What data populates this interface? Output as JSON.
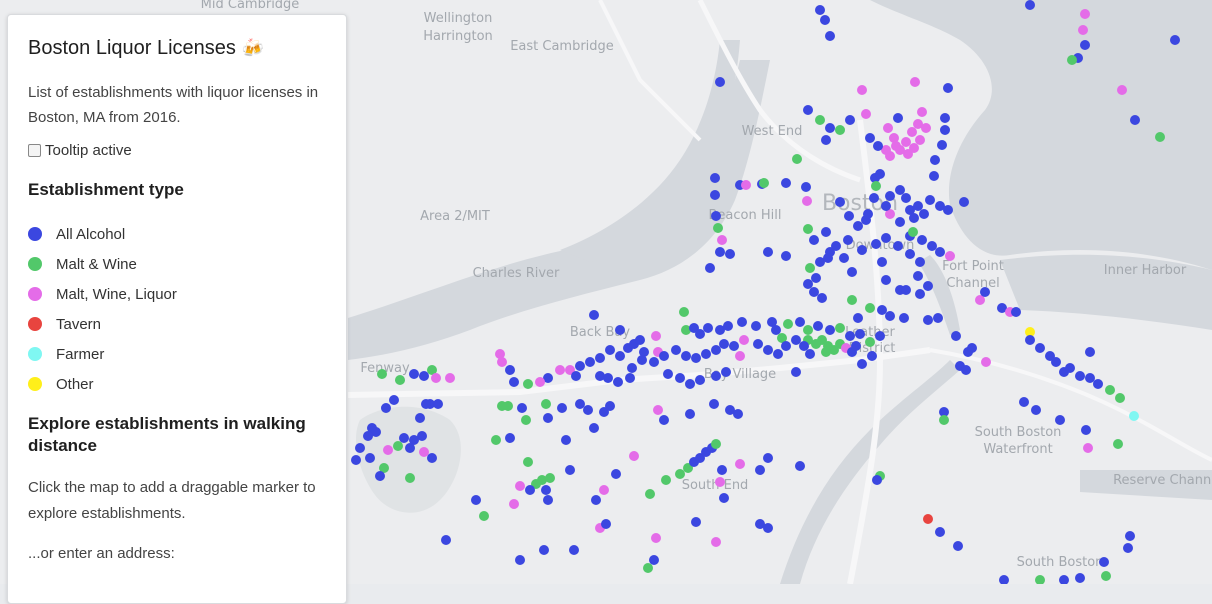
{
  "panel": {
    "title": "Boston Liquor Licenses",
    "title_icon": "beer-mugs-icon",
    "subtitle": "List of establishments with liquor licenses in Boston, MA from 2016.",
    "tooltip_label": "Tooltip active",
    "tooltip_checked": false,
    "legend_heading": "Establishment type",
    "legend": [
      {
        "label": "All Alcohol",
        "color": "#3b47e0"
      },
      {
        "label": "Malt & Wine",
        "color": "#52c86a"
      },
      {
        "label": "Malt, Wine, Liquor",
        "color": "#e46ce8"
      },
      {
        "label": "Tavern",
        "color": "#e8443f"
      },
      {
        "label": "Farmer",
        "color": "#7ff7f2"
      },
      {
        "label": "Other",
        "color": "#ffef1a"
      }
    ],
    "walking_heading": "Explore establishments in walking distance",
    "walking_text": "Click the map to add a draggable marker to explore establishments.",
    "address_prompt": "...or enter an address:"
  },
  "map": {
    "labels": [
      "Mid Cambridge",
      "Wellington Harrington",
      "East Cambridge",
      "Area 2/MIT",
      "Charles River",
      "Beacon Hill",
      "West End",
      "Boston",
      "Downtown",
      "Fort Point Channel",
      "Inner Harbor",
      "Back Bay",
      "Fenway",
      "Bay Village",
      "Leather District",
      "South Boston Waterfront",
      "South End",
      "Reserve Channel",
      "South Boston"
    ]
  }
}
